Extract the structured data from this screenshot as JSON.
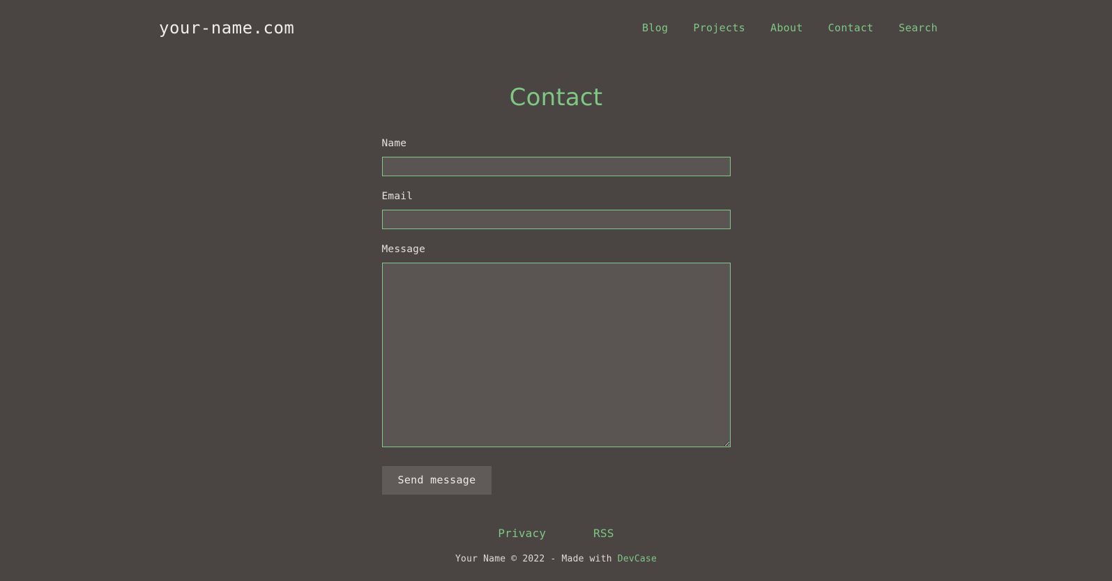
{
  "header": {
    "brand": "your-name.com",
    "nav": [
      {
        "label": "Blog"
      },
      {
        "label": "Projects"
      },
      {
        "label": "About"
      },
      {
        "label": "Contact"
      },
      {
        "label": "Search"
      }
    ]
  },
  "main": {
    "title": "Contact",
    "form": {
      "name": {
        "label": "Name",
        "value": "",
        "placeholder": ""
      },
      "email": {
        "label": "Email",
        "value": "",
        "placeholder": ""
      },
      "message": {
        "label": "Message",
        "value": "",
        "placeholder": ""
      },
      "submit_label": "Send message"
    }
  },
  "footer": {
    "links": [
      {
        "label": "Privacy"
      },
      {
        "label": "RSS"
      }
    ],
    "copyright_prefix": "Your Name © 2022 - Made with ",
    "credit_label": "DevCase"
  },
  "colors": {
    "page_background": "#4a4543",
    "accent_green": "#7fc784",
    "input_background": "#5a5552",
    "input_border": "#82c98a",
    "button_background": "#605b58",
    "text_light": "#e6e2df"
  }
}
